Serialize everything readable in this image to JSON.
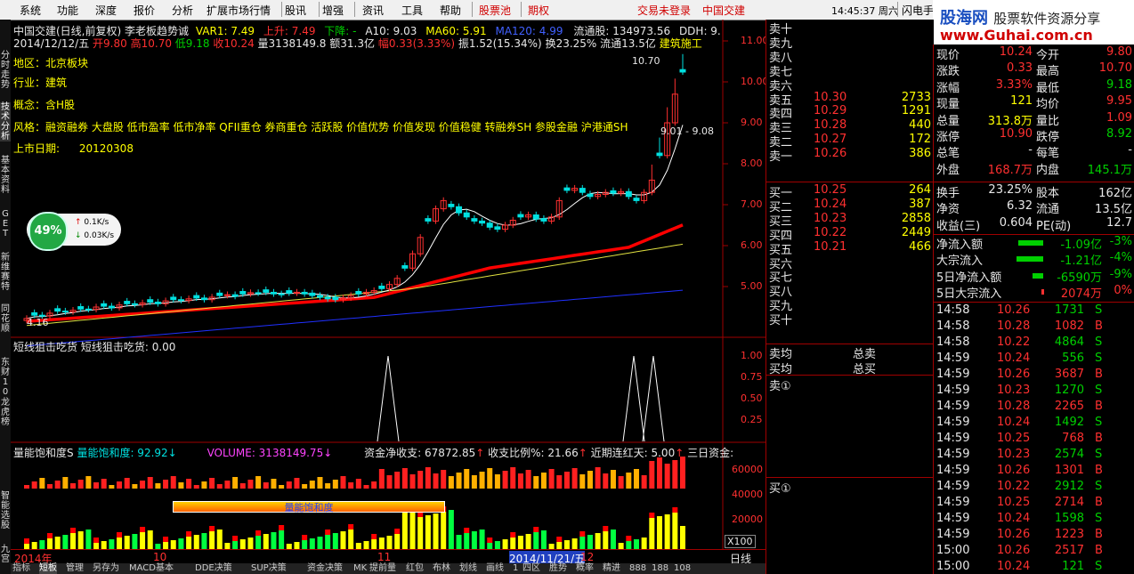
{
  "menu": {
    "items": [
      "系统",
      "功能",
      "深度",
      "报价",
      "分析",
      "扩展市场行情",
      "股讯",
      "增强",
      "资讯",
      "工具",
      "帮助",
      "股票池",
      "期权"
    ],
    "login": "交易未登录",
    "stock": "中国交建",
    "clock": "14:45:37 周六",
    "flash": "闪电手"
  },
  "logo": {
    "name": "股海网",
    "subtitle": "股票软件资源分享",
    "url": "www.Guhai.com.cn"
  },
  "left_tabs": [
    "分时走势",
    "技术分析",
    "基本资料",
    "GET",
    "新维赛特",
    "同花顺",
    "东财10",
    "龙虎榜",
    "智能选股",
    "九宫"
  ],
  "header": {
    "line1_title": "中国交建(日线,前复权)",
    "line1_indicator": "李老板趋势诚",
    "var1": "VAR1: 7.49",
    "up": "上升: 7.49",
    "down": "下降: -",
    "a10": "A10: 9.03",
    "ma60": "MA60: 5.91",
    "ma120": "MA120: 4.99",
    "float_shares": "流通股: 134973.56",
    "ddh": "DDH: 9.",
    "date": "2014/12/12/五",
    "open": "开9.80",
    "high": "高10.70",
    "low": "低9.18",
    "close": "收10.24",
    "vol": "量3138149.8",
    "amount": "额31.3亿",
    "amp": "幅0.33(3.33%)",
    "swing": "振1.52(15.34%)",
    "turnover": "换23.25%",
    "float": "流通13.5亿",
    "sector": "建筑施工"
  },
  "info_box": {
    "region_label": "地区：",
    "region": "北京板块",
    "industry_label": "行业：",
    "industry": "建筑",
    "concept_label": "概念：",
    "concept": "含H股",
    "style_label": "风格：",
    "style": "融资融券 大盘股 低市盈率 低市净率 QFII重仓 券商重仓 活跃股 价值优势 价值发现 价值稳健 转融券SH 参股金融 沪港通SH",
    "listing_label": "上市日期:",
    "listing": "20120308"
  },
  "gauge": {
    "pct": "49%",
    "up": "0.1K/s",
    "down": "0.03K/s"
  },
  "price_axis": [
    "11.00",
    "10.00",
    "9.00",
    "8.00",
    "7.00",
    "6.00",
    "5.00"
  ],
  "annotations": {
    "high": "10.70",
    "low": "4.16",
    "range": "9.01 - 9.08"
  },
  "sub1": {
    "title": "短线狙击吃货",
    "value": "短线狙击吃货: 0.00",
    "axis": [
      "1.00",
      "0.75",
      "0.50",
      "0.25"
    ]
  },
  "sub2": {
    "title": "量能饱和度S",
    "val": "量能饱和度: 92.92",
    "volume": "VOLUME: 3138149.75",
    "net": "资金净收支: 67872.85",
    "ratio": "收支比例%: 21.66",
    "streak": "近期连红天: 5.00",
    "three": "三日资金:",
    "label_box": "量能饱和度",
    "axis": [
      "60000",
      "40000",
      "20000"
    ],
    "unit": "X100"
  },
  "timeline": {
    "y2014": "2014年",
    "m10": "10",
    "m11": "11",
    "cursor": "2014/11/21/五",
    "m12": "12",
    "period": "日线"
  },
  "bottom_tabs": [
    "指标",
    "短板",
    "管理",
    "另存为",
    "MACD基本",
    "DDE决策",
    "SUP决策",
    "资金决策",
    "MK",
    "提前量",
    "红包",
    "布林",
    "划线",
    "画线",
    "1",
    "四区",
    "胜势",
    "概率",
    "精进",
    "888",
    "188",
    "108"
  ],
  "order_book": {
    "sell": [
      {
        "label": "卖十",
        "price": "",
        "vol": ""
      },
      {
        "label": "卖九",
        "price": "",
        "vol": ""
      },
      {
        "label": "卖八",
        "price": "",
        "vol": ""
      },
      {
        "label": "卖七",
        "price": "",
        "vol": ""
      },
      {
        "label": "卖六",
        "price": "",
        "vol": ""
      },
      {
        "label": "卖五",
        "price": "10.30",
        "vol": "2733"
      },
      {
        "label": "卖四",
        "price": "10.29",
        "vol": "1291"
      },
      {
        "label": "卖三",
        "price": "10.28",
        "vol": "440"
      },
      {
        "label": "卖二",
        "price": "10.27",
        "vol": "172"
      },
      {
        "label": "卖一",
        "price": "10.26",
        "vol": "386"
      }
    ],
    "buy": [
      {
        "label": "买一",
        "price": "10.25",
        "vol": "264"
      },
      {
        "label": "买二",
        "price": "10.24",
        "vol": "387"
      },
      {
        "label": "买三",
        "price": "10.23",
        "vol": "2858"
      },
      {
        "label": "买四",
        "price": "10.22",
        "vol": "2449"
      },
      {
        "label": "买五",
        "price": "10.21",
        "vol": "466"
      },
      {
        "label": "买六",
        "price": "",
        "vol": ""
      },
      {
        "label": "买七",
        "price": "",
        "vol": ""
      },
      {
        "label": "买八",
        "price": "",
        "vol": ""
      },
      {
        "label": "买九",
        "price": "",
        "vol": ""
      },
      {
        "label": "买十",
        "price": "",
        "vol": ""
      }
    ],
    "sell_avg": "卖均",
    "buy_avg": "买均",
    "total_sell": "总卖",
    "total_buy": "总买",
    "sell_circle": "卖①",
    "buy_circle": "买①"
  },
  "quote": {
    "rows": [
      {
        "l1": "现价",
        "v1": "10.24",
        "l2": "今开",
        "v2": "9.80"
      },
      {
        "l1": "涨跌",
        "v1": "0.33",
        "l2": "最高",
        "v2": "10.70"
      },
      {
        "l1": "涨幅",
        "v1": "3.33%",
        "l2": "最低",
        "v2": "9.18"
      },
      {
        "l1": "现量",
        "v1": "121",
        "l2": "均价",
        "v2": "9.95"
      },
      {
        "l1": "总量",
        "v1": "313.8万",
        "l2": "量比",
        "v2": "1.09"
      },
      {
        "l1": "涨停",
        "v1": "10.90",
        "l2": "跌停",
        "v2": "8.92"
      },
      {
        "l1": "总笔",
        "v1": "-",
        "l2": "每笔",
        "v2": "-"
      },
      {
        "l1": "外盘",
        "v1": "168.7万",
        "l2": "内盘",
        "v2": "145.1万"
      }
    ],
    "rows2": [
      {
        "l1": "换手",
        "v1": "23.25%",
        "l2": "股本",
        "v2": "162亿"
      },
      {
        "l1": "净资",
        "v1": "6.32",
        "l2": "流通",
        "v2": "13.5亿"
      },
      {
        "l1": "收益(三)",
        "v1": "0.604",
        "l2": "PE(动)",
        "v2": "12.7"
      }
    ],
    "flows": [
      {
        "label": "净流入额",
        "value": "-1.09亿",
        "pct": "-3%",
        "bar": 0.7
      },
      {
        "label": "大宗流入",
        "value": "-1.21亿",
        "pct": "-4%",
        "bar": 0.75
      },
      {
        "label": "5日净流入额",
        "value": "-6590万",
        "pct": "-9%",
        "bar": 0.3
      },
      {
        "label": "5日大宗流入",
        "value": "2074万",
        "pct": "0%",
        "bar": 0.05
      }
    ]
  },
  "ticks": [
    {
      "t": "14:58",
      "p": "10.26",
      "v": "1731",
      "s": "S"
    },
    {
      "t": "14:58",
      "p": "10.28",
      "v": "1082",
      "s": "B"
    },
    {
      "t": "14:58",
      "p": "10.22",
      "v": "4864",
      "s": "S"
    },
    {
      "t": "14:59",
      "p": "10.24",
      "v": "556",
      "s": "S"
    },
    {
      "t": "14:59",
      "p": "10.26",
      "v": "3687",
      "s": "B"
    },
    {
      "t": "14:59",
      "p": "10.23",
      "v": "1270",
      "s": "S"
    },
    {
      "t": "14:59",
      "p": "10.28",
      "v": "2265",
      "s": "B"
    },
    {
      "t": "14:59",
      "p": "10.24",
      "v": "1492",
      "s": "S"
    },
    {
      "t": "14:59",
      "p": "10.25",
      "v": "768",
      "s": "B"
    },
    {
      "t": "14:59",
      "p": "10.23",
      "v": "2574",
      "s": "S"
    },
    {
      "t": "14:59",
      "p": "10.26",
      "v": "1301",
      "s": "B"
    },
    {
      "t": "14:59",
      "p": "10.22",
      "v": "2912",
      "s": "S"
    },
    {
      "t": "14:59",
      "p": "10.25",
      "v": "2714",
      "s": "B"
    },
    {
      "t": "14:59",
      "p": "10.24",
      "v": "1598",
      "s": "S"
    },
    {
      "t": "14:59",
      "p": "10.26",
      "v": "1223",
      "s": "B"
    },
    {
      "t": "15:00",
      "p": "10.26",
      "v": "2517",
      "s": "B"
    },
    {
      "t": "15:00",
      "p": "10.24",
      "v": "121",
      "s": "S"
    }
  ],
  "colors": {
    "up": "#ff3030",
    "down": "#00e0e0",
    "ma_red": "#ff0000",
    "ma_yellow": "#e0e040",
    "ma_blue": "#2030ff",
    "bg": "#000000",
    "grid": "#a00000"
  }
}
